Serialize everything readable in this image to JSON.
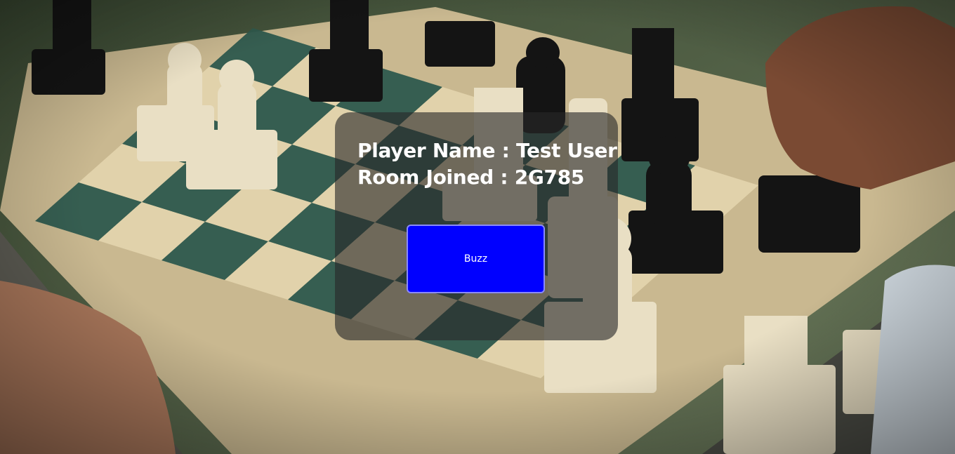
{
  "background": {
    "description_icon": "chessboard-photo",
    "board_light": "#d9c9a3",
    "board_dark": "#2f5a4e"
  },
  "panel": {
    "player_label": "Player Name",
    "player_value": "Test User",
    "room_label": "Room Joined",
    "room_value": "2G785",
    "separator": " : "
  },
  "buzz_button": {
    "label": "Buzz",
    "color": "#0000ff"
  }
}
